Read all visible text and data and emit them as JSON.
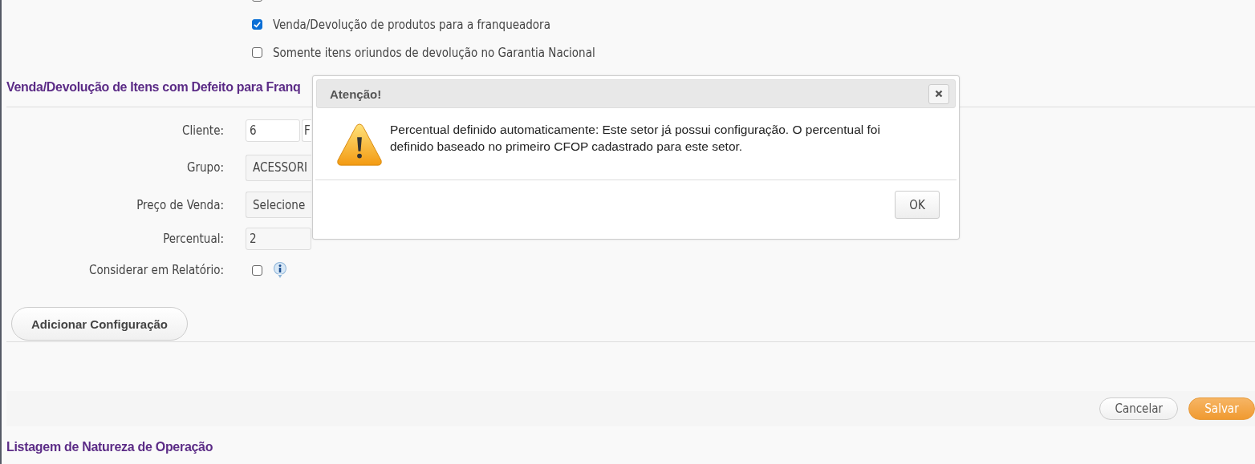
{
  "options": [
    {
      "checked": false
    },
    {
      "label": "Venda/Devolução de produtos para a franqueadora",
      "checked": true
    },
    {
      "label": "Somente itens oriundos de devolução no Garantia Nacional",
      "checked": false
    }
  ],
  "section_title": "Venda/Devolução de Itens com Defeito para Franq",
  "form": [
    {
      "kind": "input2",
      "label": "Cliente:",
      "value": "6",
      "value_2": "F"
    },
    {
      "kind": "select",
      "label": "Grupo:",
      "value": "ACESSORI"
    },
    {
      "kind": "select",
      "label": "Preço de Venda:",
      "value": "Selecione"
    },
    {
      "kind": "input",
      "label": "Percentual:",
      "value": "2"
    },
    {
      "kind": "checkbox",
      "label": "Considerar em Relatório:",
      "checked": false
    }
  ],
  "add_button": "Adicionar Configuração",
  "footer_buttons": [
    {
      "label": "Cancelar",
      "kind": "secondary"
    },
    {
      "label": "Salvar",
      "kind": "primary"
    }
  ],
  "list_title": "Listagem de Natureza de Operação",
  "dialog": {
    "title": "Atenção!",
    "message": "Percentual definido automaticamente: Este setor já possui configuração. O percentual foi definido baseado no primeiro CFOP cadastrado para este setor.",
    "button": "OK"
  }
}
